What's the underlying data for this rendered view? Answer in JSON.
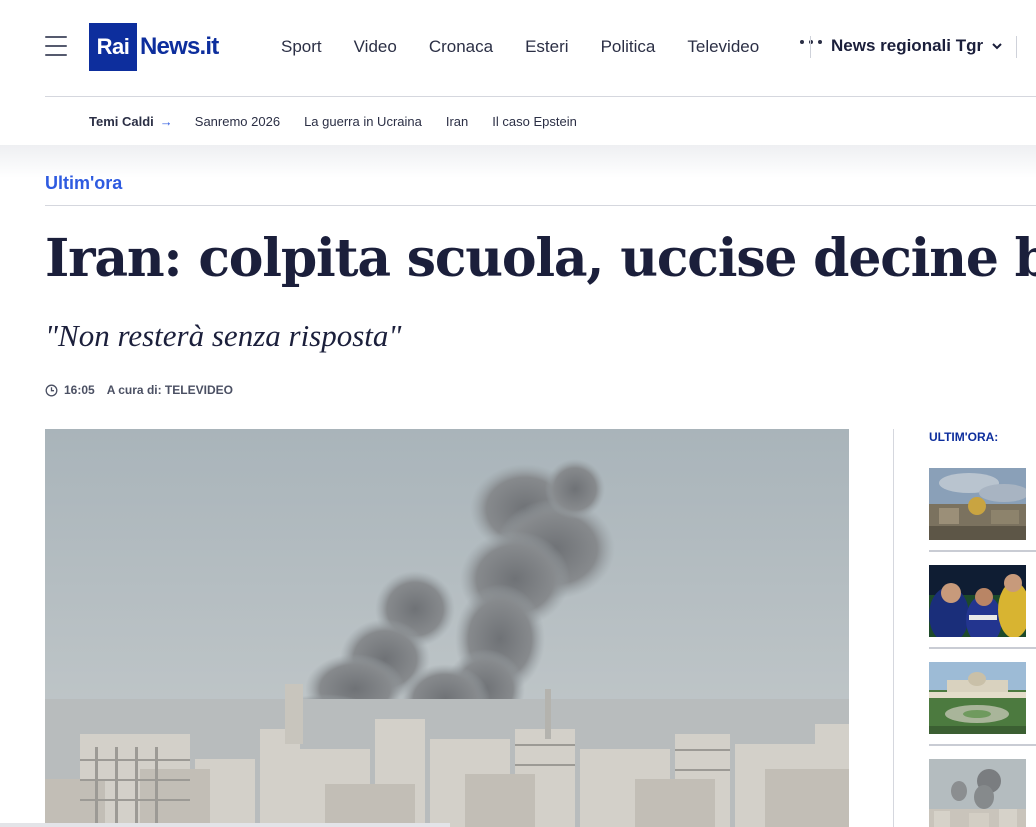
{
  "header": {
    "logo_rai": "Rai",
    "logo_news": "News.it",
    "nav": [
      "Sport",
      "Video",
      "Cronaca",
      "Esteri",
      "Politica",
      "Televideo"
    ],
    "regional_label": "News regionali Tgr"
  },
  "topics": {
    "lead": "Temi Caldi",
    "items": [
      "Sanremo 2026",
      "La guerra in Ucraina",
      "Iran",
      "Il caso Epstein"
    ]
  },
  "article": {
    "section": "Ultim'ora",
    "headline": "Iran: colpita scuola, uccise decine bimbe",
    "subtitle": "\"Non resterà senza risposta\"",
    "time": "16:05",
    "byline": "A cura di: TELEVIDEO"
  },
  "sidebar": {
    "title": "ULTIM'ORA:"
  },
  "colors": {
    "brand": "#0d2e9d",
    "accent": "#2e5be0",
    "text": "#1b1f3b"
  }
}
